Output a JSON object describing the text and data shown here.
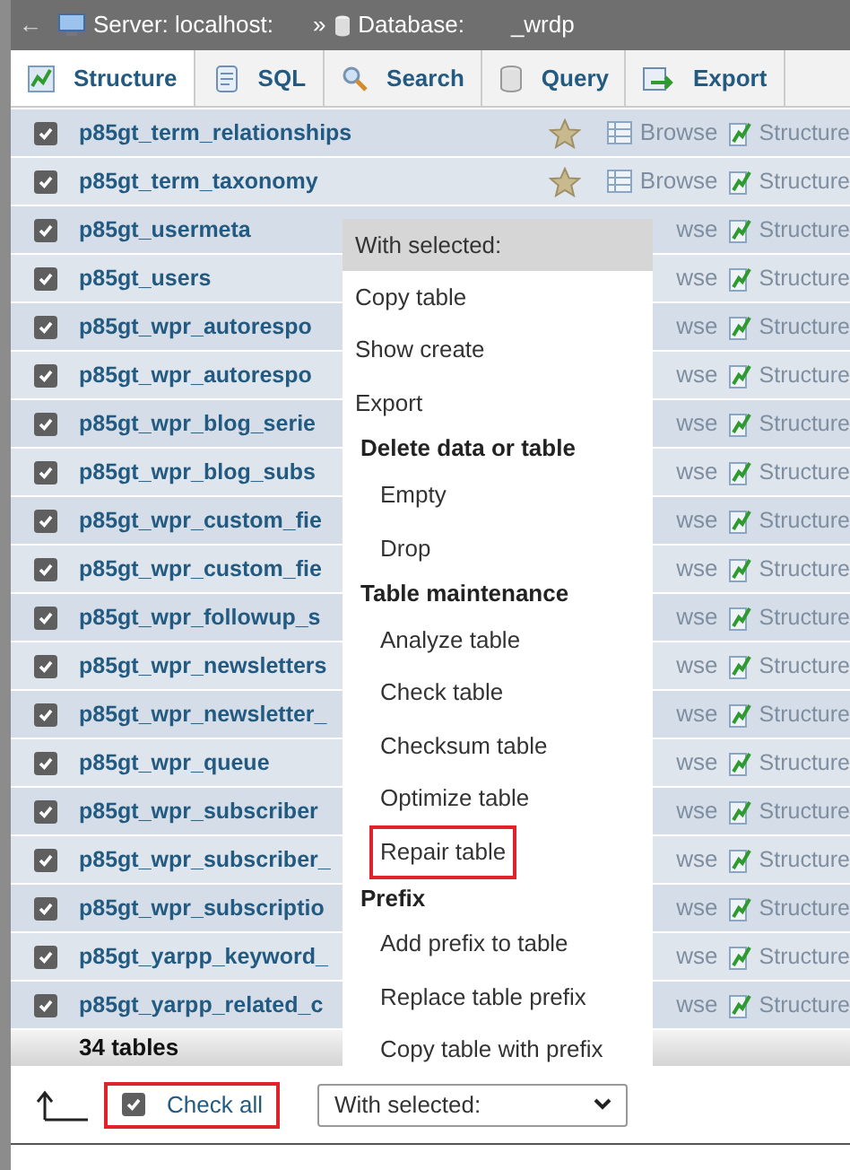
{
  "breadcrumb": {
    "back": "←",
    "server": "Server: localhost:",
    "separator": "»",
    "database": "Database:",
    "database_suffix": "_wrdp"
  },
  "tabs": [
    {
      "label": "Structure",
      "selected": true
    },
    {
      "label": "SQL",
      "selected": false
    },
    {
      "label": "Search",
      "selected": false
    },
    {
      "label": "Query",
      "selected": false
    },
    {
      "label": "Export",
      "selected": false
    }
  ],
  "rows": [
    {
      "name": "p85gt_term_relationships",
      "checked": true,
      "kind": "full",
      "browse": "Browse",
      "structure": "Structure"
    },
    {
      "name": "p85gt_term_taxonomy",
      "checked": true,
      "kind": "full",
      "browse": "Browse",
      "structure": "Structure"
    },
    {
      "name": "p85gt_usermeta",
      "checked": true,
      "kind": "covered",
      "browse": "wse",
      "structure": "Structure"
    },
    {
      "name": "p85gt_users",
      "checked": true,
      "kind": "covered",
      "browse": "wse",
      "structure": "Structure"
    },
    {
      "name": "p85gt_wpr_autorespo",
      "checked": true,
      "kind": "covered",
      "browse": "wse",
      "structure": "Structure"
    },
    {
      "name": "p85gt_wpr_autorespo",
      "checked": true,
      "kind": "covered",
      "browse": "wse",
      "structure": "Structure"
    },
    {
      "name": "p85gt_wpr_blog_serie",
      "checked": true,
      "kind": "covered",
      "browse": "wse",
      "structure": "Structure"
    },
    {
      "name": "p85gt_wpr_blog_subs",
      "checked": true,
      "kind": "covered",
      "browse": "wse",
      "structure": "Structure"
    },
    {
      "name": "p85gt_wpr_custom_fie",
      "checked": true,
      "kind": "covered",
      "browse": "wse",
      "structure": "Structure"
    },
    {
      "name": "p85gt_wpr_custom_fie",
      "checked": true,
      "kind": "covered",
      "browse": "wse",
      "structure": "Structure"
    },
    {
      "name": "p85gt_wpr_followup_s",
      "checked": true,
      "kind": "covered",
      "browse": "wse",
      "structure": "Structure"
    },
    {
      "name": "p85gt_wpr_newsletters",
      "checked": true,
      "kind": "covered",
      "browse": "wse",
      "structure": "Structure"
    },
    {
      "name": "p85gt_wpr_newsletter_",
      "checked": true,
      "kind": "covered",
      "browse": "wse",
      "structure": "Structure"
    },
    {
      "name": "p85gt_wpr_queue",
      "checked": true,
      "kind": "covered",
      "browse": "wse",
      "structure": "Structure"
    },
    {
      "name": "p85gt_wpr_subscriber",
      "checked": true,
      "kind": "covered",
      "browse": "wse",
      "structure": "Structure"
    },
    {
      "name": "p85gt_wpr_subscriber_",
      "checked": true,
      "kind": "covered",
      "browse": "wse",
      "structure": "Structure"
    },
    {
      "name": "p85gt_wpr_subscriptio",
      "checked": true,
      "kind": "covered",
      "browse": "wse",
      "structure": "Structure"
    },
    {
      "name": "p85gt_yarpp_keyword_",
      "checked": true,
      "kind": "covered",
      "browse": "wse",
      "structure": "Structure"
    },
    {
      "name": "p85gt_yarpp_related_c",
      "checked": true,
      "kind": "covered",
      "browse": "wse",
      "structure": "Structure"
    }
  ],
  "footer": {
    "count": "34 tables"
  },
  "menu": {
    "items": [
      {
        "kind": "header",
        "label": "With selected:",
        "highlighted": false
      },
      {
        "kind": "item",
        "label": "Copy table",
        "highlighted": false
      },
      {
        "kind": "item",
        "label": "Show create",
        "highlighted": false
      },
      {
        "kind": "item",
        "label": "Export",
        "highlighted": false
      },
      {
        "kind": "group",
        "label": "Delete data or table",
        "highlighted": false
      },
      {
        "kind": "subitem",
        "label": "Empty",
        "highlighted": false
      },
      {
        "kind": "subitem",
        "label": "Drop",
        "highlighted": false
      },
      {
        "kind": "group",
        "label": "Table maintenance",
        "highlighted": false
      },
      {
        "kind": "subitem",
        "label": "Analyze table",
        "highlighted": false
      },
      {
        "kind": "subitem",
        "label": "Check table",
        "highlighted": false
      },
      {
        "kind": "subitem",
        "label": "Checksum table",
        "highlighted": false
      },
      {
        "kind": "subitem",
        "label": "Optimize table",
        "highlighted": false
      },
      {
        "kind": "subitem",
        "label": "Repair table",
        "highlighted": true
      },
      {
        "kind": "group",
        "label": "Prefix",
        "highlighted": false
      },
      {
        "kind": "subitem",
        "label": "Add prefix to table",
        "highlighted": false
      },
      {
        "kind": "subitem",
        "label": "Replace table prefix",
        "highlighted": false
      },
      {
        "kind": "subitem",
        "label": "Copy table with prefix",
        "highlighted": false
      }
    ]
  },
  "bottom": {
    "check_all": {
      "label": "Check all",
      "checked": true,
      "highlighted": true
    },
    "select": {
      "value": "With selected:"
    }
  }
}
